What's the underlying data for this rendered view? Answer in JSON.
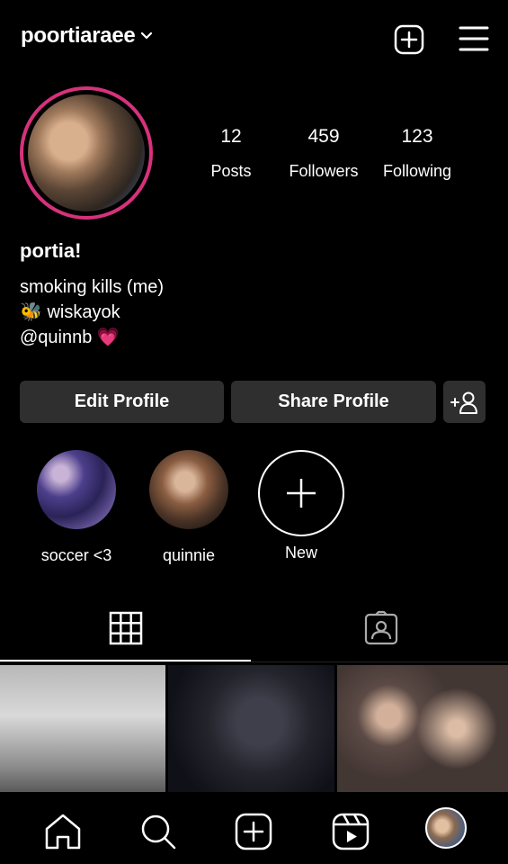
{
  "header": {
    "username": "poortiaraee",
    "icons": [
      "chevron-down-icon",
      "new-post-icon",
      "menu-icon"
    ]
  },
  "profile": {
    "display_name": "portia!",
    "bio_lines": [
      "smoking kills (me)",
      "🐝 wiskayok",
      "@quinnb 💗"
    ],
    "ring_color": "#d6327c"
  },
  "stats": [
    {
      "value": "12",
      "label": "Posts"
    },
    {
      "value": "459",
      "label": "Followers"
    },
    {
      "value": "123",
      "label": "Following"
    }
  ],
  "actions": {
    "edit_label": "Edit Profile",
    "share_label": "Share Profile",
    "add_icon": "add-person-icon"
  },
  "highlights": [
    {
      "label": "soccer <3"
    },
    {
      "label": "quinnie"
    },
    {
      "label": "New"
    }
  ],
  "tabs": [
    {
      "name": "posts-grid",
      "icon": "grid-icon",
      "active": true
    },
    {
      "name": "tagged",
      "icon": "tagged-icon",
      "active": false
    }
  ],
  "nav": [
    "home-icon",
    "search-icon",
    "create-icon",
    "reels-icon",
    "profile-avatar"
  ]
}
